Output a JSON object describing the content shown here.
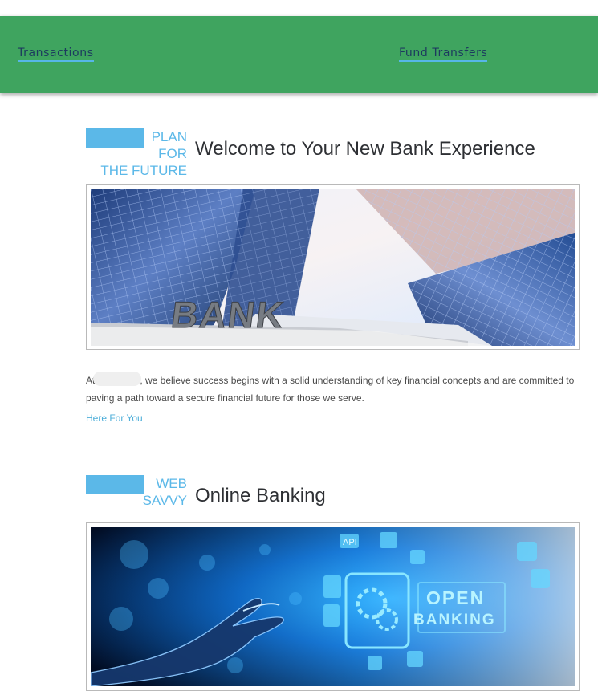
{
  "nav": {
    "transactions": "Transactions",
    "fund_transfers": "Fund Transfers"
  },
  "sections": [
    {
      "kicker_lines": [
        "PLAN",
        "FOR",
        "THE FUTURE"
      ],
      "heading": "Welcome to Your New Bank Experience",
      "image_text": "BANK",
      "intro_prefix": "At",
      "intro_body": ", we believe success begins with a solid understanding of key financial concepts and are committed to paving a path toward a secure financial future for those we serve.",
      "link_text": "Here For You"
    },
    {
      "kicker_lines": [
        "WEB",
        "SAVVY"
      ],
      "heading": "Online Banking",
      "image_text": [
        "OPEN",
        "BANKING"
      ],
      "image_small_label": "API"
    }
  ],
  "colors": {
    "nav_background": "#3fa45f",
    "accent": "#5bb8e8",
    "heading": "#2e3034",
    "body_text": "#4a4a4a"
  }
}
